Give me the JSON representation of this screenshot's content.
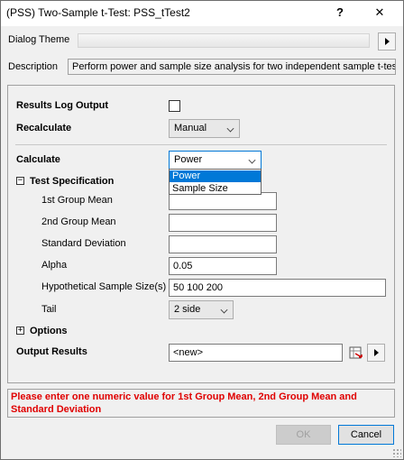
{
  "window": {
    "title": "(PSS) Two-Sample t-Test: PSS_tTest2",
    "help_glyph": "?",
    "close_glyph": "✕"
  },
  "dialog_theme": {
    "label": "Dialog Theme"
  },
  "description": {
    "label": "Description",
    "text": "Perform power and sample size analysis for two independent sample t-test."
  },
  "settings": {
    "results_log_output": {
      "label": "Results Log Output",
      "checked": false
    },
    "recalculate": {
      "label": "Recalculate",
      "value": "Manual"
    },
    "calculate": {
      "label": "Calculate",
      "value": "Power",
      "options": [
        "Power",
        "Sample Size"
      ]
    }
  },
  "test_specification": {
    "label": "Test Specification",
    "expander": "−",
    "fields": {
      "group1_mean": {
        "label": "1st Group Mean",
        "value": ""
      },
      "group2_mean": {
        "label": "2nd Group Mean",
        "value": ""
      },
      "std_dev": {
        "label": "Standard Deviation",
        "value": ""
      },
      "alpha": {
        "label": "Alpha",
        "value": "0.05"
      },
      "hyp_sample_size": {
        "label": "Hypothetical Sample Size(s)",
        "value": "50 100 200"
      },
      "tail": {
        "label": "Tail",
        "value": "2 side"
      }
    }
  },
  "options": {
    "label": "Options",
    "expander": "+"
  },
  "output_results": {
    "label": "Output Results",
    "value": "<new>"
  },
  "error_message": "Please enter one numeric value for 1st Group Mean, 2nd Group Mean and Standard Deviation",
  "buttons": {
    "ok": "OK",
    "cancel": "Cancel"
  },
  "colors": {
    "accent": "#0078d7",
    "error": "#e00000"
  }
}
